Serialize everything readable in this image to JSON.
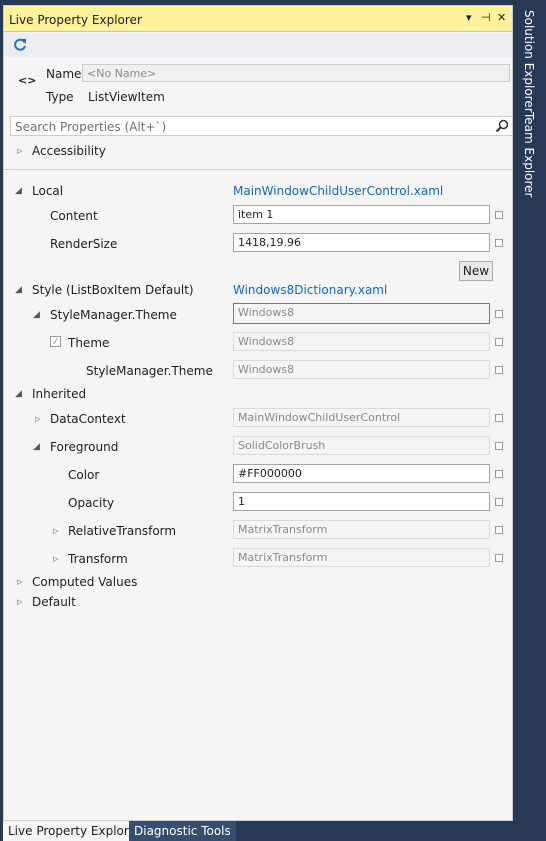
{
  "window": {
    "title": "Live Property Explorer",
    "dropdown_glyph": "▾",
    "pin_glyph": "⊣",
    "close_glyph": "✕"
  },
  "header": {
    "name_label": "Name",
    "name_placeholder": "<No Name>",
    "type_label": "Type",
    "type_value": "ListViewItem",
    "element_icon": "<>"
  },
  "search": {
    "placeholder": "Search Properties (Alt+`)"
  },
  "sections": {
    "accessibility": "Accessibility",
    "local": {
      "label": "Local",
      "source": "MainWindowChildUserControl.xaml",
      "content_label": "Content",
      "content_value": "item 1",
      "rendersize_label": "RenderSize",
      "rendersize_value": "1418,19.96",
      "new_button": "New"
    },
    "style": {
      "label": "Style (ListBoxItem Default)",
      "source": "Windows8Dictionary.xaml",
      "stylemanager_label": "StyleManager.Theme",
      "stylemanager_value": "Windows8",
      "theme_label": "Theme",
      "theme_value": "Windows8",
      "nested_label": "StyleManager.Theme",
      "nested_value": "Windows8"
    },
    "inherited": {
      "label": "Inherited",
      "datacontext_label": "DataContext",
      "datacontext_value": "MainWindowChildUserControl",
      "foreground_label": "Foreground",
      "foreground_value": "SolidColorBrush",
      "color_label": "Color",
      "color_value": "#FF000000",
      "opacity_label": "Opacity",
      "opacity_value": "1",
      "relativetransform_label": "RelativeTransform",
      "relativetransform_value": "MatrixTransform",
      "transform_label": "Transform",
      "transform_value": "MatrixTransform"
    },
    "computed": "Computed Values",
    "default": "Default"
  },
  "bottom_tabs": [
    "Live Property Explorer",
    "Diagnostic Tools"
  ],
  "side_tabs": [
    "Solution Explorer",
    "Team Explorer"
  ],
  "colors": {
    "title_bg": "#fff29d",
    "link": "#1565c0",
    "frame": "#293955",
    "active_border": "#39a046"
  }
}
